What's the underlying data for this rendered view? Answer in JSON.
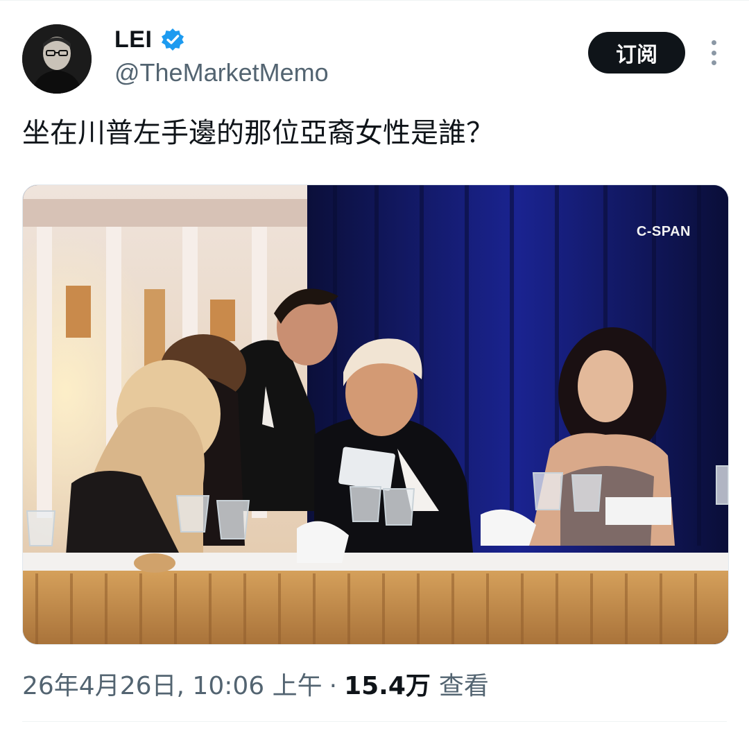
{
  "author": {
    "display_name": "LEI",
    "handle": "@TheMarketMemo",
    "verified_icon": "verified-badge-icon",
    "avatar_icon": "user-avatar"
  },
  "actions": {
    "subscribe_label": "订阅",
    "more_icon": "more-vertical-icon"
  },
  "tweet": {
    "text": "坐在川普左手邊的那位亞裔女性是誰？"
  },
  "media": {
    "watermark": "C-SPAN"
  },
  "meta": {
    "timestamp": "26年4月26日, 10:06 上午",
    "separator": "·",
    "views_count": "15.4万",
    "views_label": "查看"
  },
  "colors": {
    "verified_blue": "#1d9bf0",
    "button_bg": "#0f1419",
    "secondary_text": "#536471"
  }
}
